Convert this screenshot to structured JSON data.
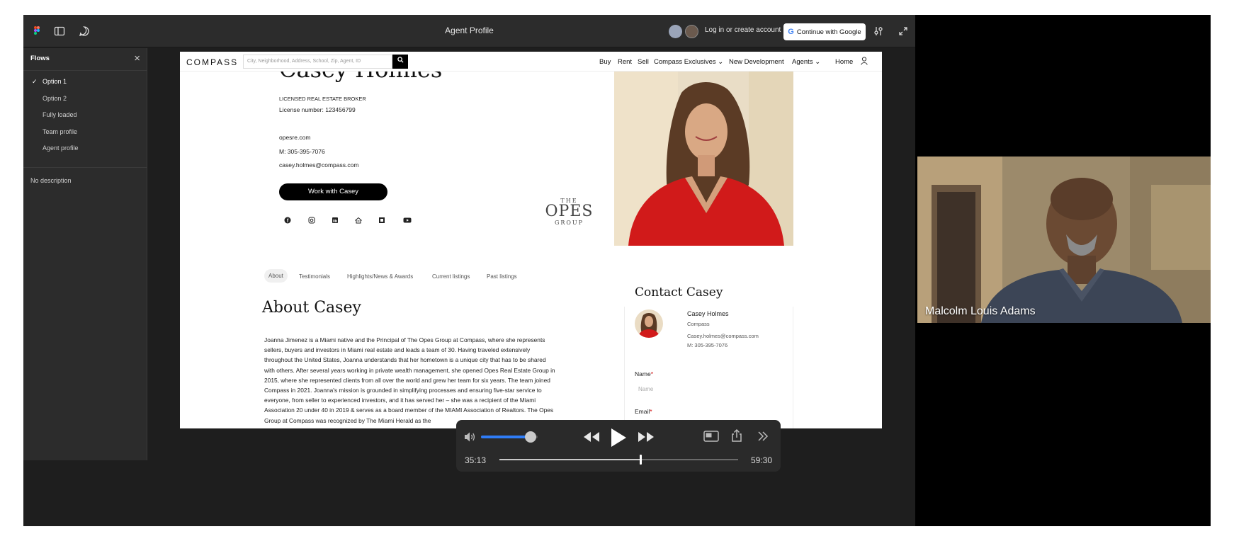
{
  "figma": {
    "title": "Agent Profile",
    "login_label": "Log in or create account",
    "google_label": "Continue with Google",
    "google_letter": "G",
    "icons": [
      "figma-logo-icon",
      "sidebar-toggle-icon",
      "comment-icon",
      "settings-sliders-icon",
      "expand-icon"
    ],
    "sidebar": {
      "title": "Flows",
      "close": "×",
      "check": "✓",
      "items": [
        {
          "label": "Option 1",
          "active": true
        },
        {
          "label": "Option 2",
          "active": false
        },
        {
          "label": "Fully loaded",
          "active": false
        },
        {
          "label": "Team profile",
          "active": false
        },
        {
          "label": "Agent profile",
          "active": false
        }
      ],
      "description": "No description"
    }
  },
  "compass": {
    "logo": "COMPASS",
    "search_placeholder": "City, Neighborhood, Address, School, Zip, Agent, ID",
    "nav": [
      "Buy",
      "Rent",
      "Sell",
      "Compass Exclusives ⌄",
      "New Development",
      "Agents ⌄",
      "Home"
    ],
    "agent_name": "Casey Holmes",
    "title": "LICENSED REAL ESTATE BROKER",
    "license": "License number: 123456799",
    "website": "opesre.com",
    "phone": "M: 305-395-7076",
    "email": "casey.holmes@compass.com",
    "cta": "Work with Casey",
    "social_icons": [
      "facebook-icon",
      "instagram-icon",
      "linkedin-icon",
      "zillow-icon",
      "realtor-icon",
      "youtube-icon"
    ],
    "logo_group": {
      "the": "THE",
      "main": "OPES",
      "group": "GROUP"
    },
    "tabs": [
      "About",
      "Testimonials",
      "Highlights/News & Awards",
      "Current listings",
      "Past listings"
    ],
    "about_title": "About Casey",
    "bio_lines": [
      "Joanna Jimenez is a Miami native and the Principal of The Opes Group at Compass, where she represents",
      "sellers, buyers and investors in Miami real estate and leads a team of 30.  Having traveled extensively",
      "throughout the United States, Joanna understands that her hometown is a unique city that has to be shared",
      "with others. After several years working in private wealth management, she opened Opes Real Estate Group in",
      "2015, where she represented clients from all over the world and grew her team for six years. The team joined",
      "Compass in 2021. Joanna's mission is grounded in simplifying processes and ensuring five-star service to",
      "everyone, from seller to experienced investors, and it has served her – she was a recipient of the Miami",
      "Association 20 under 40 in 2019 & serves as a board member of the MIAMI Association of Realtors. The Opes",
      "Group at Compass was recognized by The Miami Herald as the"
    ],
    "contact_title": "Contact Casey",
    "contact": {
      "name": "Casey Holmes",
      "company": "Compass",
      "email": "Casey.holmes@compass.com",
      "phone": "M: 305-395-7076"
    },
    "form": {
      "name_label": "Name",
      "name_placeholder": "Name",
      "email_label": "Email",
      "required": "*"
    }
  },
  "player": {
    "current_time": "35:13",
    "total_time": "59:30",
    "volume": 0.88,
    "progress": 0.59,
    "icons": [
      "volume-icon",
      "rewind-icon",
      "play-icon",
      "fast-forward-icon",
      "picture-in-picture-icon",
      "share-icon",
      "more-icon"
    ]
  },
  "participant": {
    "name": "Malcolm Louis Adams"
  },
  "colors": {
    "accent_blue": "#2f7cf6",
    "cta_black": "#000000",
    "dress_red": "#d11a1a"
  }
}
